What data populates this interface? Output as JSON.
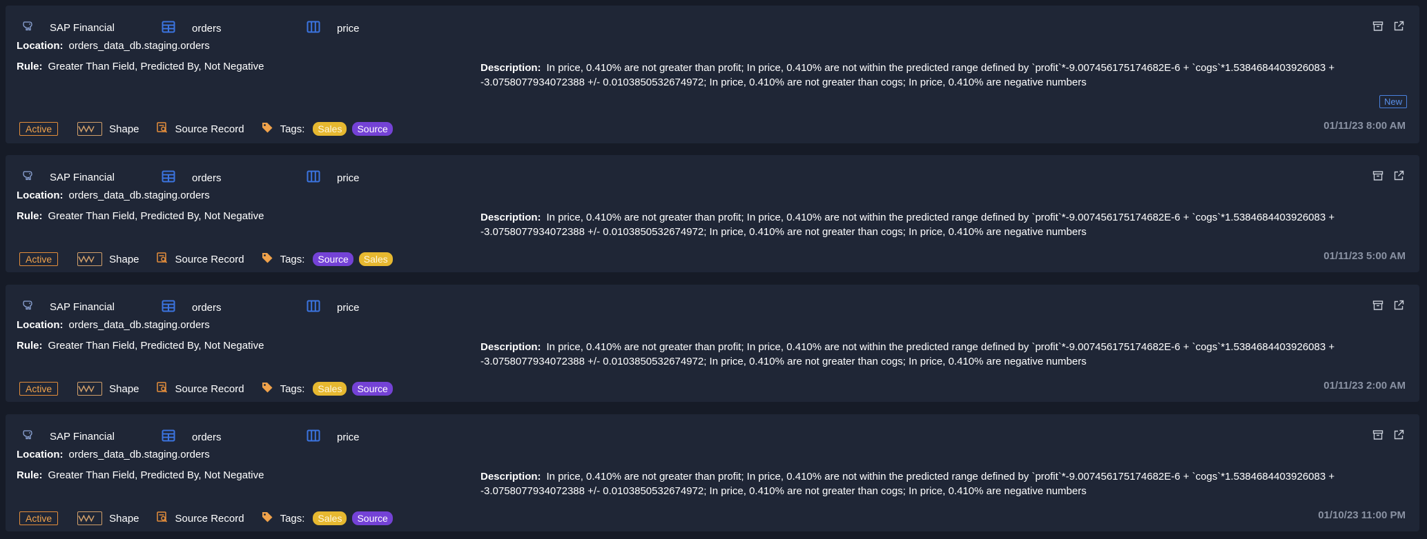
{
  "colors": {
    "background": "#161b27",
    "card": "#1f2636",
    "status_active": "#e58e3b",
    "tag_sales": "#e6b830",
    "tag_source": "#7442d6",
    "new_badge": "#4a82e0",
    "accent_blue": "#3b74e0"
  },
  "labels": {
    "location": "Location:",
    "rule": "Rule:",
    "description": "Description:",
    "shape": "Shape",
    "source_record": "Source Record",
    "tags": "Tags:",
    "new": "New"
  },
  "icons": {
    "source": "postgres-elephant-icon",
    "table": "table-icon",
    "column": "column-icon",
    "archive": "archive-icon",
    "open": "external-link-icon",
    "shape": "shape-icon",
    "source_record": "source-record-icon",
    "tags": "tag-icon"
  },
  "cards": [
    {
      "source": "SAP Financial",
      "table": "orders",
      "column": "price",
      "location": "orders_data_db.staging.orders",
      "rule": "Greater Than Field, Predicted By, Not Negative",
      "description": "In price, 0.410% are not greater than profit; In price, 0.410% are not within the predicted range defined by `profit`*-9.007456175174682E-6 + `cogs`*1.5384684403926083 + -3.0758077934072388 +/- 0.0103850532674972; In price, 0.410% are not greater than cogs; In price, 0.410% are negative numbers",
      "status": "Active",
      "tags": [
        "Sales",
        "Source"
      ],
      "date": "01/11/23 8:00 AM",
      "is_new": true
    },
    {
      "source": "SAP Financial",
      "table": "orders",
      "column": "price",
      "location": "orders_data_db.staging.orders",
      "rule": "Greater Than Field, Predicted By, Not Negative",
      "description": "In price, 0.410% are not greater than profit; In price, 0.410% are not within the predicted range defined by `profit`*-9.007456175174682E-6 + `cogs`*1.5384684403926083 + -3.0758077934072388 +/- 0.0103850532674972; In price, 0.410% are not greater than cogs; In price, 0.410% are negative numbers",
      "status": "Active",
      "tags": [
        "Source",
        "Sales"
      ],
      "date": "01/11/23 5:00 AM",
      "is_new": false
    },
    {
      "source": "SAP Financial",
      "table": "orders",
      "column": "price",
      "location": "orders_data_db.staging.orders",
      "rule": "Greater Than Field, Predicted By, Not Negative",
      "description": "In price, 0.410% are not greater than profit; In price, 0.410% are not within the predicted range defined by `profit`*-9.007456175174682E-6 + `cogs`*1.5384684403926083 + -3.0758077934072388 +/- 0.0103850532674972; In price, 0.410% are not greater than cogs; In price, 0.410% are negative numbers",
      "status": "Active",
      "tags": [
        "Sales",
        "Source"
      ],
      "date": "01/11/23 2:00 AM",
      "is_new": false
    },
    {
      "source": "SAP Financial",
      "table": "orders",
      "column": "price",
      "location": "orders_data_db.staging.orders",
      "rule": "Greater Than Field, Predicted By, Not Negative",
      "description": "In price, 0.410% are not greater than profit; In price, 0.410% are not within the predicted range defined by `profit`*-9.007456175174682E-6 + `cogs`*1.5384684403926083 + -3.0758077934072388 +/- 0.0103850532674972; In price, 0.410% are not greater than cogs; In price, 0.410% are negative numbers",
      "status": "Active",
      "tags": [
        "Sales",
        "Source"
      ],
      "date": "01/10/23 11:00 PM",
      "is_new": false
    }
  ]
}
